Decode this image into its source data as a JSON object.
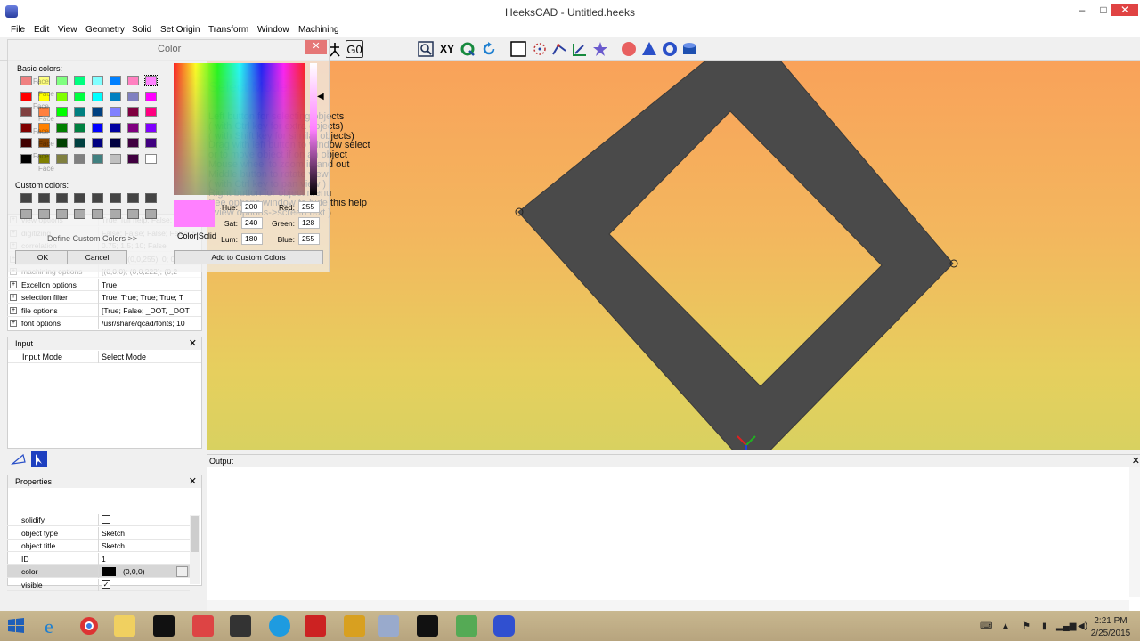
{
  "window": {
    "title": "HeeksCAD - Untitled.heeks",
    "controls": [
      "–",
      "□",
      "✕"
    ]
  },
  "menu": [
    "File",
    "Edit",
    "View",
    "Geometry",
    "Solid",
    "Set Origin",
    "Transform",
    "Window",
    "Machining"
  ],
  "toolbar": {
    "g0_label": "G0",
    "xy_label": "XY"
  },
  "color_dialog": {
    "title": "Color",
    "basic_label": "Basic colors:",
    "custom_label": "Custom colors:",
    "define_label": "Define Custom Colors >>",
    "ok_label": "OK",
    "cancel_label": "Cancel",
    "color_solid_label": "Color|Solid",
    "add_custom_label": "Add to Custom Colors",
    "hue_label": "Hue:",
    "hue": "200",
    "sat_label": "Sat:",
    "sat": "240",
    "lum_label": "Lum:",
    "lum": "180",
    "red_label": "Red:",
    "red": "255",
    "green_label": "Green:",
    "green": "128",
    "blue_label": "Blue:",
    "blue": "255",
    "basic_colors": [
      "#f08080",
      "#ffff80",
      "#80ff80",
      "#00ff80",
      "#80ffff",
      "#0080ff",
      "#ff80c0",
      "#ff80ff",
      "#ff0000",
      "#ffff00",
      "#80ff00",
      "#00ff40",
      "#00ffff",
      "#0080c0",
      "#8080c0",
      "#ff00ff",
      "#804040",
      "#ff8040",
      "#00ff00",
      "#008080",
      "#004080",
      "#8080ff",
      "#800040",
      "#ff0080",
      "#800000",
      "#ff8000",
      "#008000",
      "#008040",
      "#0000ff",
      "#0000a0",
      "#800080",
      "#8000ff",
      "#400000",
      "#804000",
      "#004000",
      "#004040",
      "#000080",
      "#000040",
      "#400040",
      "#400080",
      "#000000",
      "#808000",
      "#808040",
      "#808080",
      "#408080",
      "#c0c0c0",
      "#400040",
      "#ffffff"
    ],
    "ghost_labels": [
      "Face",
      "Face",
      "Face",
      "Face",
      "Face",
      "Face",
      "Face",
      "Face"
    ]
  },
  "options_rows": [
    {
      "key": "view options",
      "value": "True; full help; False; False"
    },
    {
      "key": "digitizing",
      "value": "False; False; False; False; 5; 5"
    },
    {
      "key": "correlation",
      "value": "0.75; 1.5; 10; False"
    },
    {
      "key": "drawing",
      "value": "(0,0,0); (0,0,255); 0; 0.0"
    },
    {
      "key": "machining options",
      "value": "[(0,0,0); (0,0,222); (0,2"
    },
    {
      "key": "Excellon options",
      "value": "True"
    },
    {
      "key": "selection filter",
      "value": "True; True; True; True; T"
    },
    {
      "key": "file options",
      "value": "[True; False; _DOT, _DOT"
    },
    {
      "key": "font options",
      "value": "/usr/share/qcad/fonts; 10"
    }
  ],
  "input_panel": {
    "title": "Input",
    "row_key": "Input Mode",
    "row_value": "Select Mode"
  },
  "properties_panel": {
    "title": "Properties",
    "rows": [
      {
        "key": "solidify",
        "value": ""
      },
      {
        "key": "object type",
        "value": "Sketch"
      },
      {
        "key": "object title",
        "value": "Sketch"
      },
      {
        "key": "ID",
        "value": "1"
      },
      {
        "key": "color",
        "value": "(0,0,0)"
      },
      {
        "key": "visible",
        "value": ""
      }
    ],
    "ellipsis": "..."
  },
  "help": {
    "title": "Select Mode",
    "lines": [
      "Left button for selecting objects",
      "( with Ctrl key for extra objects)",
      "( with Shift key for similar objects)",
      "Drag with left button to window select",
      "or to move object if on an object",
      "Mouse wheel to zoom in and out",
      "Middle button to rotate view",
      "( with Ctrl key to pan view )",
      "Right button for object menu",
      "See options window to hide this help",
      "( view options->screen text )"
    ]
  },
  "output_panel": {
    "title": "Output"
  },
  "taskbar": {
    "time": "2:21 PM",
    "date": "2/25/2015"
  },
  "colors": {
    "sketch_fill": "#4a4a4a",
    "accent": "#3a6fd8",
    "close_red": "#e04343"
  }
}
